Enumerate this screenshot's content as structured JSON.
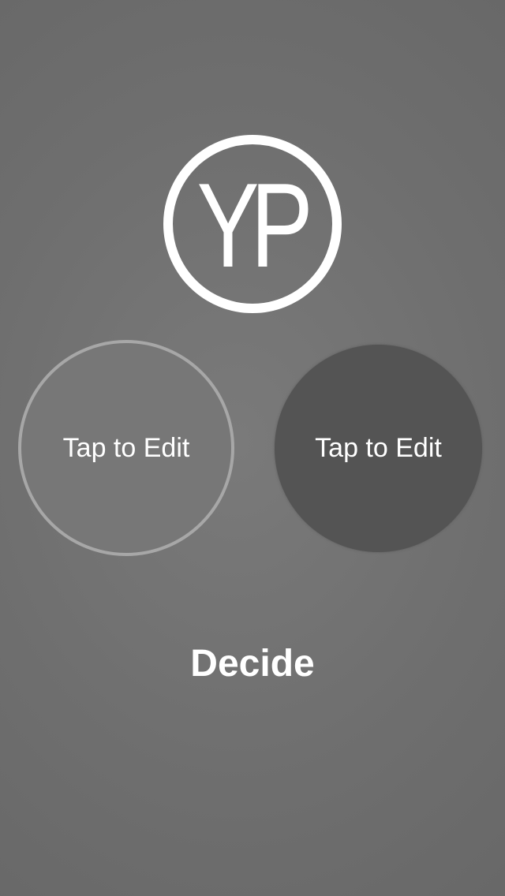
{
  "logo": {
    "text": "YP"
  },
  "options": [
    {
      "label": "Tap to Edit",
      "state": "selected"
    },
    {
      "label": "Tap to Edit",
      "state": "unselected"
    }
  ],
  "decide": {
    "label": "Decide"
  },
  "colors": {
    "background": "#707070",
    "option_selected_fill": "#777777",
    "option_selected_border": "#a7a7a7",
    "option_unselected_fill": "#545454",
    "text": "#ffffff"
  }
}
